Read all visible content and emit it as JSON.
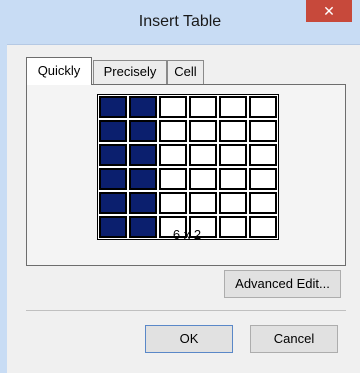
{
  "window": {
    "title": "Insert Table",
    "close_glyph": "✕"
  },
  "tabs": [
    {
      "label": "Quickly",
      "active": true
    },
    {
      "label": "Precisely",
      "active": false
    },
    {
      "label": "Cell",
      "active": false
    }
  ],
  "grid": {
    "rows": 6,
    "cols": 6,
    "selected_rows": 6,
    "selected_cols": 2,
    "size_label": "6 x 2",
    "selected_color": "#0b1f6e"
  },
  "buttons": {
    "advanced_edit": "Advanced Edit...",
    "ok": "OK",
    "cancel": "Cancel"
  }
}
